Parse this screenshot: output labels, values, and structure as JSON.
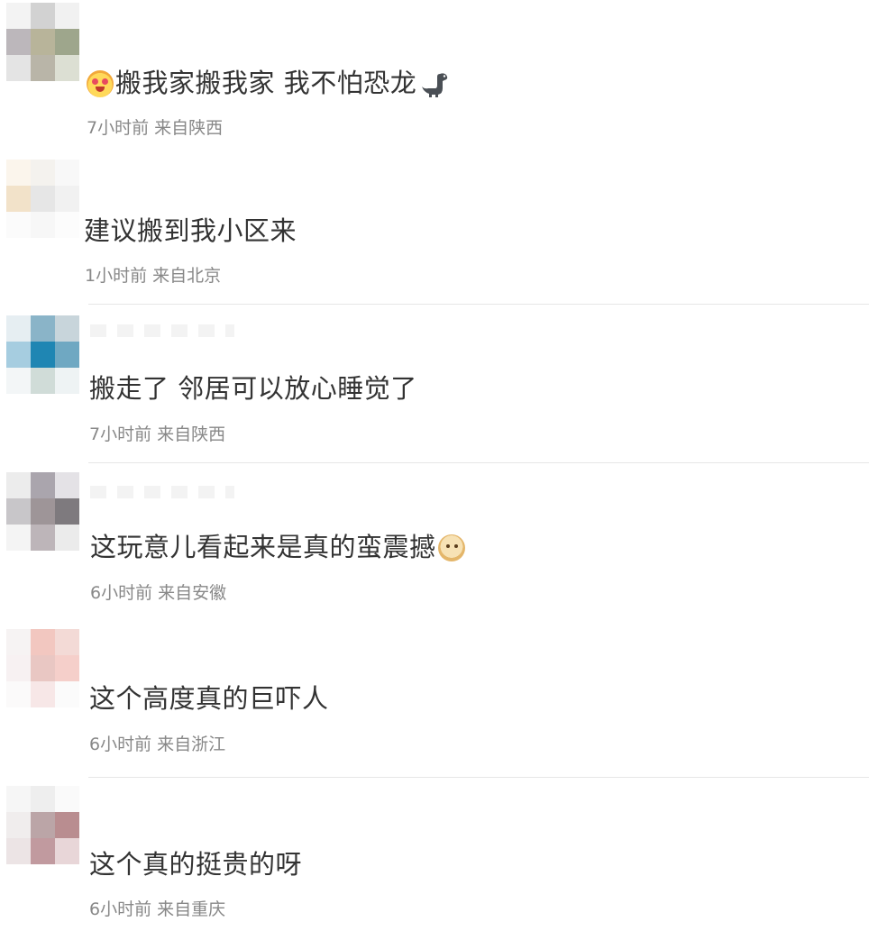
{
  "comments": [
    {
      "text": "搬我家搬我家 我不怕恐龙",
      "emoji_before": "heart-eyes-face-icon",
      "emoji_after": "dinosaur-icon",
      "meta": "7小时前 来自陕西",
      "avatar_colors": [
        "#f3f3f3",
        "#d2d2d2",
        "#f1f1f1",
        "#bcb7bb",
        "#b8b49a",
        "#9ea68c",
        "#e4e4e4",
        "#b9b5a8",
        "#dcdfd3"
      ]
    },
    {
      "text": "建议搬到我小区来",
      "meta": "1小时前 来自北京",
      "avatar_colors": [
        "#fbf5ec",
        "#f4f2ee",
        "#f8f8f8",
        "#f2e2c9",
        "#e6e6e6",
        "#f1f1f1",
        "#fbfbfb",
        "#f7f7f7",
        "#fcfcfc"
      ]
    },
    {
      "text": "搬走了 邻居可以放心睡觉了",
      "meta": "7小时前 来自陕西",
      "avatar_colors": [
        "#e6eef2",
        "#8ab4c8",
        "#c8d5db",
        "#a6cde0",
        "#1f86b3",
        "#6fa8c2",
        "#f3f6f7",
        "#d0dcd8",
        "#eef3f4"
      ]
    },
    {
      "text": "这玩意儿看起来是真的蛮震撼",
      "emoji_after": "doge-icon",
      "meta": "6小时前 来自安徽",
      "avatar_colors": [
        "#ececec",
        "#aaa5ad",
        "#e4e2e6",
        "#c8c6c9",
        "#9e9598",
        "#7e7a7e",
        "#f4f4f4",
        "#bdb5b9",
        "#ebebeb"
      ]
    },
    {
      "text": "这个高度真的巨吓人",
      "meta": "6小时前 来自浙江",
      "avatar_colors": [
        "#f6f3f3",
        "#f2c7c0",
        "#f3dad6",
        "#f7f1f2",
        "#e9c7c3",
        "#f5cfca",
        "#fbfafa",
        "#f7e7e7",
        "#fbfbfb"
      ]
    },
    {
      "text": "这个真的挺贵的呀",
      "meta": "6小时前 来自重庆",
      "avatar_colors": [
        "#f6f6f6",
        "#eeeeee",
        "#fafafa",
        "#f0eded",
        "#bba5a7",
        "#b98d90",
        "#ece4e5",
        "#c19a9f",
        "#e8d6d8"
      ]
    }
  ]
}
